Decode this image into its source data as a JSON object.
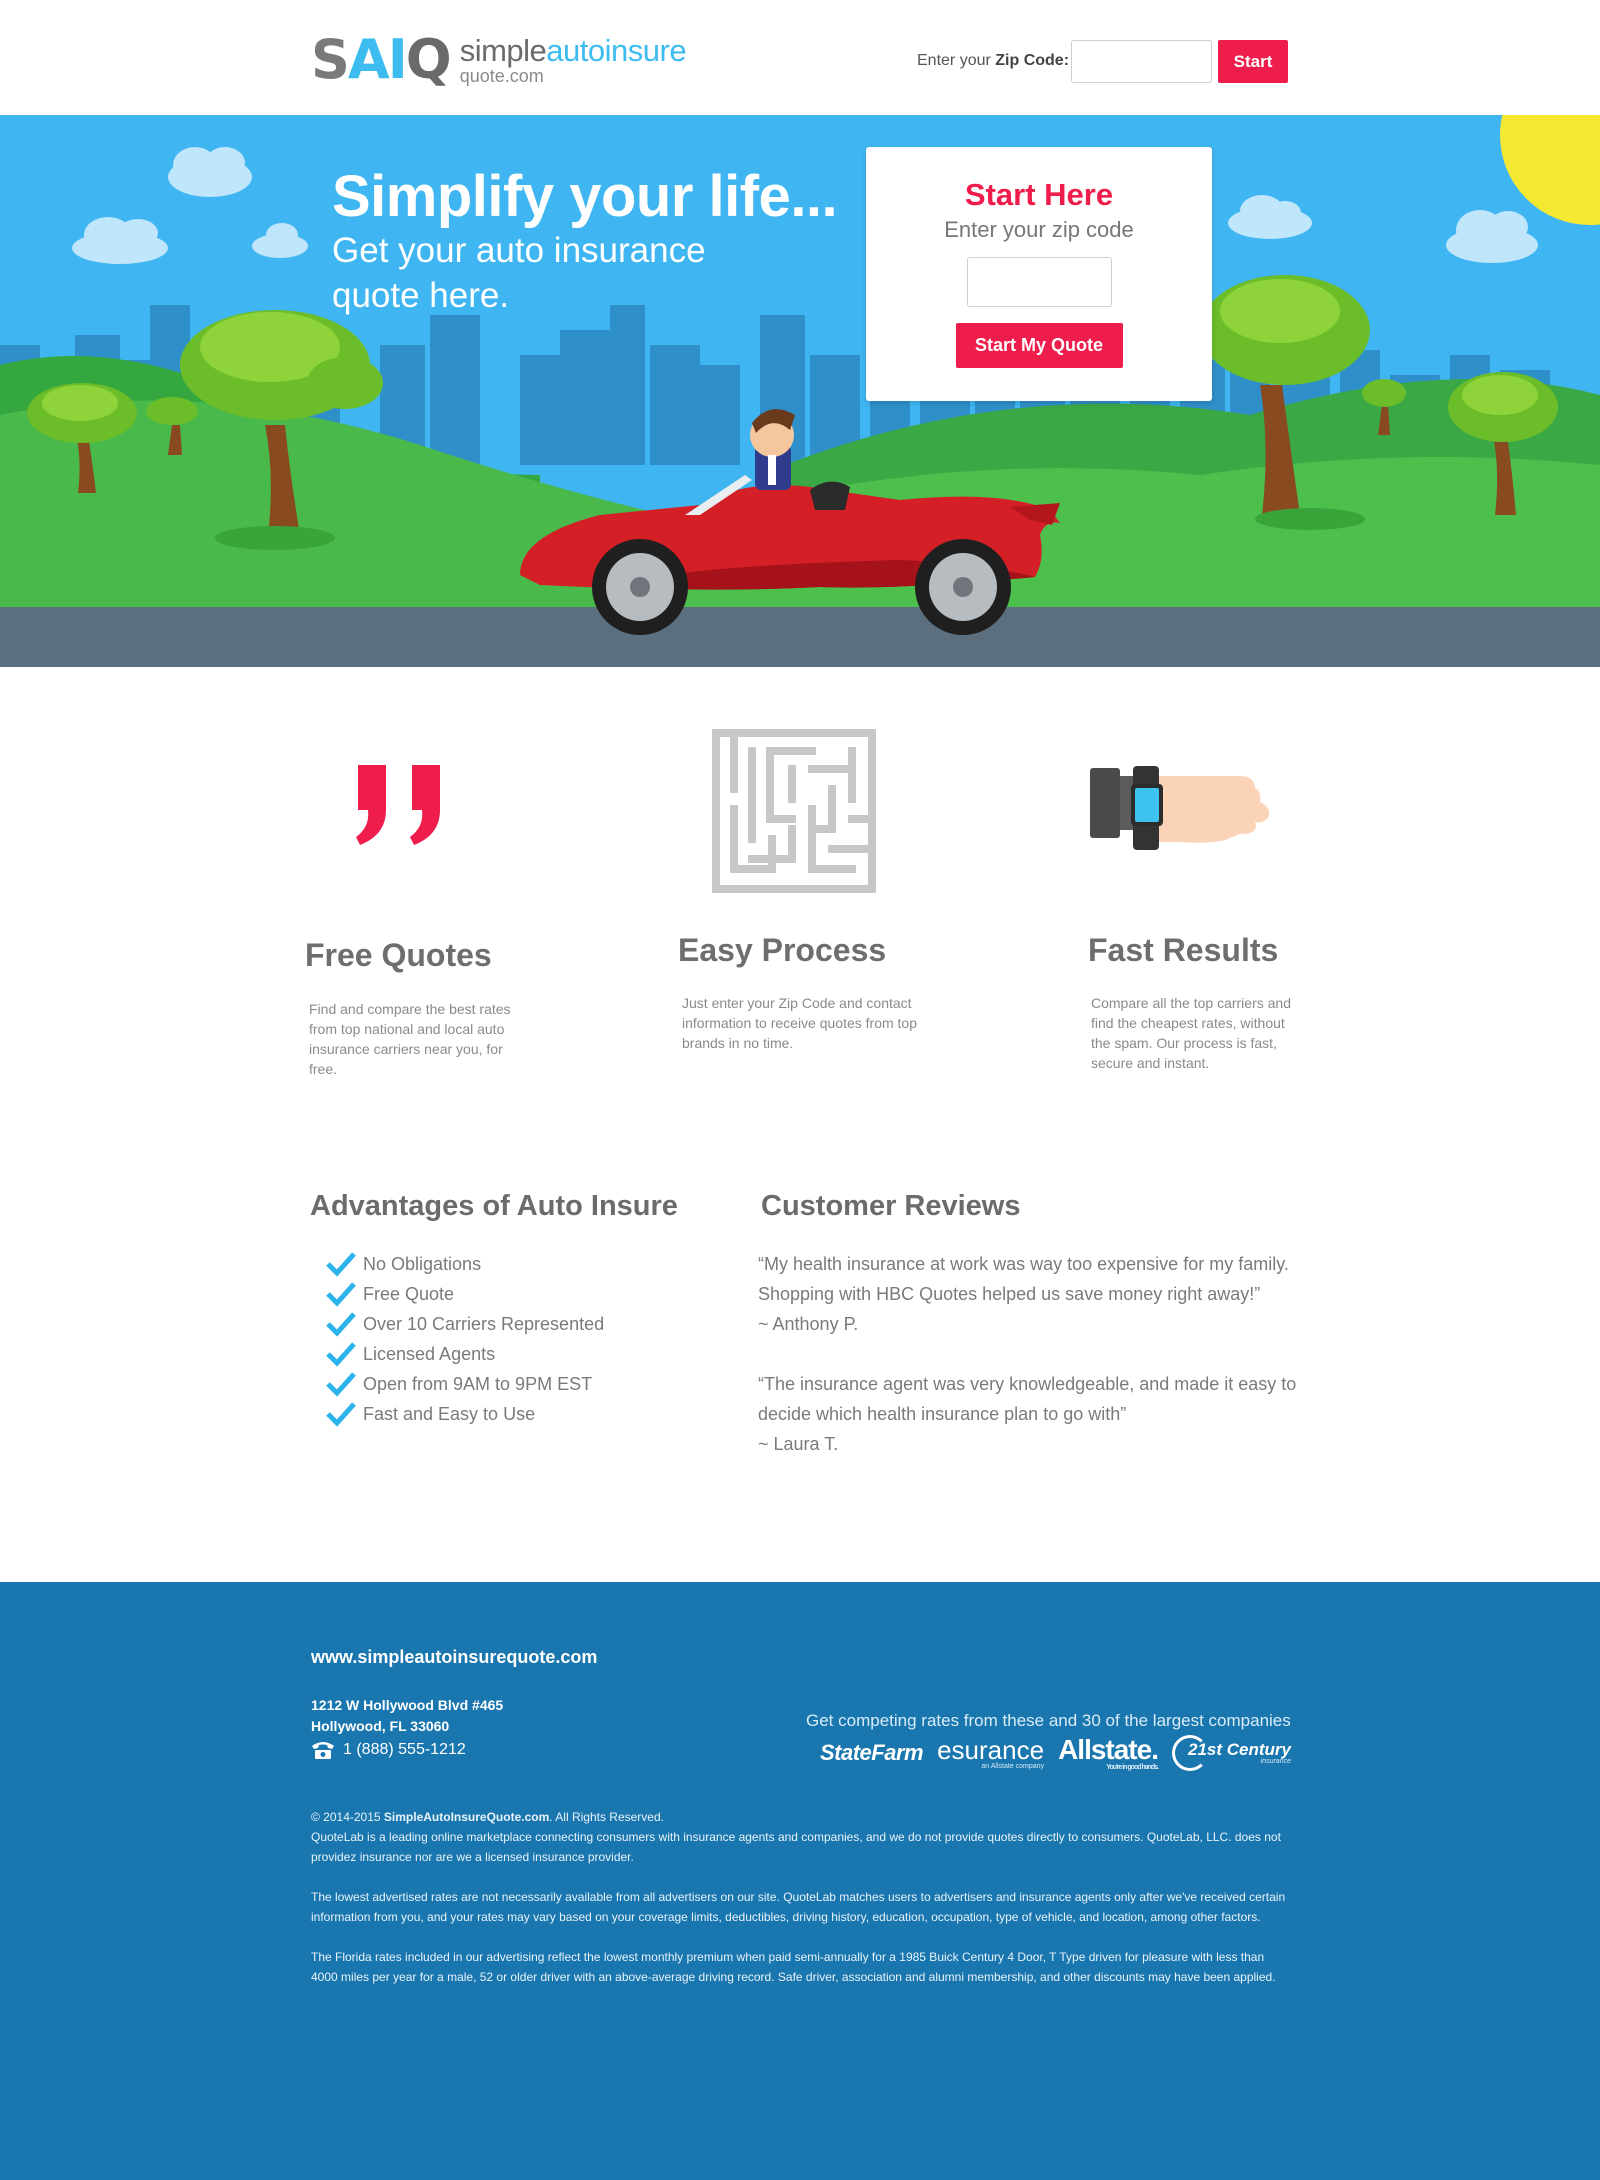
{
  "header": {
    "logo_mark": {
      "s": "S",
      "ai": "AI",
      "q": "Q"
    },
    "logo_line1_a": "simple",
    "logo_line1_b": "autoinsure",
    "logo_line2": "quote.com",
    "zip_label_prefix": "Enter your ",
    "zip_label_bold": "Zip Code:",
    "start_label": "Start"
  },
  "hero": {
    "title": "Simplify your life...",
    "subtitle": "Get your auto insurance quote here.",
    "box_title": "Start Here",
    "box_subtitle": "Enter your zip code",
    "button_label": "Start My Quote"
  },
  "features": [
    {
      "icon": "quote-marks-icon",
      "title": "Free Quotes",
      "text": "Find and compare the best rates from top national and local auto insurance carriers near you, for free."
    },
    {
      "icon": "maze-icon",
      "title": "Easy Process",
      "text": "Just enter your Zip Code and contact information to receive quotes from top brands in no time."
    },
    {
      "icon": "smartwatch-icon",
      "title": "Fast Results",
      "text": "Compare all the top carriers and find the cheapest rates, without the spam. Our process is fast, secure and instant."
    }
  ],
  "advantages": {
    "title": "Advantages of Auto Insure",
    "items": [
      "No Obligations",
      "Free Quote",
      "Over 10 Carriers Represented",
      "Licensed Agents",
      "Open from 9AM to 9PM EST",
      "Fast and Easy to Use"
    ]
  },
  "reviews": {
    "title": "Customer Reviews",
    "items": [
      {
        "quote": "“My health insurance at work was way too expensive for my family. Shopping with HBC Quotes helped us save money right away!”",
        "author": "~ Anthony P."
      },
      {
        "quote": "“The insurance agent was very knowledgeable, and made it easy to decide which health insurance plan to go with”",
        "author": "~ Laura T."
      }
    ]
  },
  "footer": {
    "site": "www.simpleautoinsurequote.com",
    "address_line1": "1212 W Hollywood Blvd #465",
    "address_line2": "Hollywood, FL 33060",
    "phone": "1 (888) 555-1212",
    "carriers_text": "Get competing rates from these and 30 of the largest companies",
    "carriers": {
      "statefarm": "StateFarm",
      "esurance": "esurance",
      "esurance_tag": "an Allstate company",
      "allstate": "Allstate.",
      "allstate_tag": "You're in good hands.",
      "c21": "21st Century",
      "c21_tag": "insurance"
    },
    "copyright_prefix": "© 2014-2015 ",
    "copyright_bold": "SimpleAutoInsureQuote.com",
    "copyright_suffix": ". All Rights Reserved.",
    "legal1": "QuoteLab is a leading online marketplace connecting consumers with insurance agents and companies, and we do not provide quotes directly to consumers. QuoteLab, LLC. does not providez insurance nor are we a licensed insurance provider.",
    "legal2": "The lowest advertised rates are not necessarily available from all advertisers on our site. QuoteLab matches users to advertisers and insurance agents only after we've received certain information from you, and your rates may vary based on your coverage limits, deductibles, driving history, education, occupation, type of vehicle, and location, among other factors.",
    "legal3": "The Florida rates included in our advertising reflect the lowest monthly premium when paid semi-annually for a 1985 Buick Century 4 Door, T Type driven for pleasure with less than 4000 miles per year for a male, 52 or older driver with an above-average driving record. Safe driver, association and alumni membership, and other discounts may have been applied."
  },
  "colors": {
    "accent": "#ee1d4b",
    "sky": "#3fb6f2",
    "footer": "#1976ae",
    "check": "#2bb3ec"
  }
}
